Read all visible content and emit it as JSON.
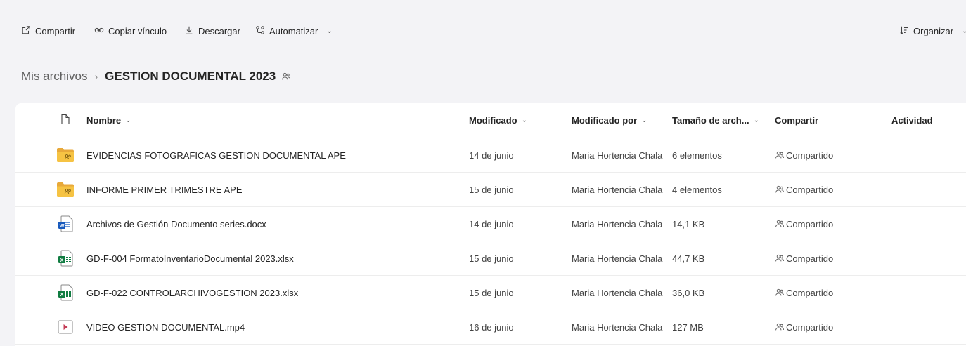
{
  "toolbar": {
    "share_label": "Compartir",
    "copy_link_label": "Copiar vínculo",
    "download_label": "Descargar",
    "automate_label": "Automatizar",
    "sort_label": "Organizar"
  },
  "breadcrumb": {
    "root": "Mis archivos",
    "current": "GESTION DOCUMENTAL 2023"
  },
  "table": {
    "headers": {
      "name": "Nombre",
      "modified": "Modificado",
      "modified_by": "Modificado por",
      "size": "Tamaño de arch...",
      "sharing": "Compartir",
      "activity": "Actividad"
    },
    "rows": [
      {
        "type": "folder",
        "name": "EVIDENCIAS FOTOGRAFICAS GESTION DOCUMENTAL APE",
        "modified": "14 de junio",
        "modified_by": "Maria Hortencia Chala",
        "size": "6 elementos",
        "sharing": "Compartido"
      },
      {
        "type": "folder",
        "name": "INFORME PRIMER TRIMESTRE APE",
        "modified": "15 de junio",
        "modified_by": "Maria Hortencia Chala",
        "size": "4 elementos",
        "sharing": "Compartido"
      },
      {
        "type": "word",
        "name": "Archivos de Gestión Documento series.docx",
        "modified": "14 de junio",
        "modified_by": "Maria Hortencia Chala",
        "size": "14,1 KB",
        "sharing": "Compartido"
      },
      {
        "type": "excel",
        "name": "GD-F-004 FormatoInventarioDocumental 2023.xlsx",
        "modified": "15 de junio",
        "modified_by": "Maria Hortencia Chala",
        "size": "44,7 KB",
        "sharing": "Compartido"
      },
      {
        "type": "excel",
        "name": "GD-F-022 CONTROLARCHIVOGESTION 2023.xlsx",
        "modified": "15 de junio",
        "modified_by": "Maria Hortencia Chala",
        "size": "36,0 KB",
        "sharing": "Compartido"
      },
      {
        "type": "video",
        "name": "VIDEO GESTION DOCUMENTAL.mp4",
        "modified": "16 de junio",
        "modified_by": "Maria Hortencia Chala",
        "size": "127 MB",
        "sharing": "Compartido"
      }
    ]
  },
  "colors": {
    "folder": "#f6c343",
    "word": "#185abd",
    "excel": "#107c41",
    "video": "#c43e58",
    "background": "#f3f3f6"
  }
}
